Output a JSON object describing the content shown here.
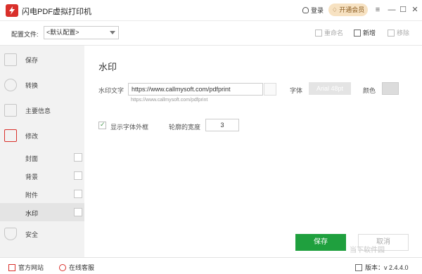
{
  "app": {
    "title": "闪电PDF虚拟打印机"
  },
  "titlebar": {
    "login_label": "登录",
    "vip_label": "开通会员",
    "menu_icon": "≡",
    "minimize_icon": "—",
    "maximize_icon": "☐",
    "close_icon": "✕"
  },
  "config": {
    "label": "配置文件:",
    "selected": "<默认配置>",
    "rename_label": "重命名",
    "new_label": "新增",
    "remove_label": "移除"
  },
  "sidebar": {
    "items": [
      {
        "label": "保存"
      },
      {
        "label": "转换"
      },
      {
        "label": "主要信息"
      },
      {
        "label": "修改"
      }
    ],
    "sub_items": [
      {
        "label": "封面"
      },
      {
        "label": "背景"
      },
      {
        "label": "附件"
      },
      {
        "label": "水印",
        "active": true
      }
    ],
    "security_label": "安全"
  },
  "watermark_panel": {
    "title": "水印",
    "text_label": "水印文字",
    "text_value": "https://www.callmysoft.com/pdfprint",
    "hint": "https://www.callmysoft.com/pdfprint",
    "font_label": "字体",
    "font_value": "Arial 48pt",
    "color_label": "颜色",
    "color_value": "#dcdcdc",
    "show_outline_label": "显示字体外框",
    "show_outline_checked": true,
    "outline_width_label": "轮廓的宽度",
    "outline_width_value": "3",
    "save_label": "保存",
    "cancel_label": "取消"
  },
  "footer": {
    "website_label": "官方网站",
    "support_label": "在线客服",
    "version_label": "版本：v 2.4.4.0"
  },
  "brand_watermark": "当下软件园",
  "colors": {
    "accent_green": "#1fa03e",
    "brand_red": "#d9302b",
    "vip_gold": "#f7e2c2"
  }
}
